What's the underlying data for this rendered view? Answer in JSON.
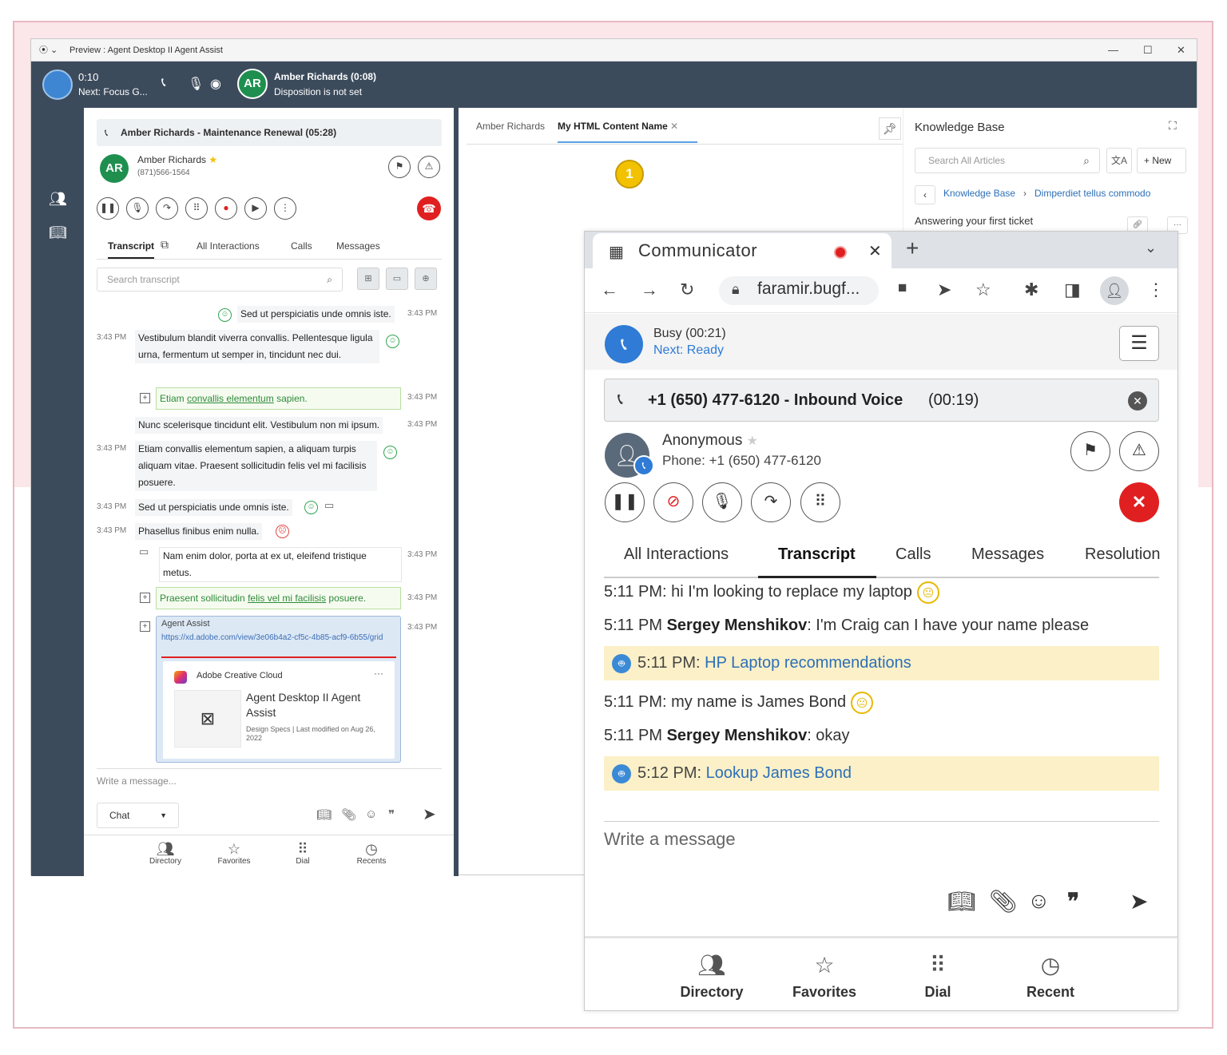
{
  "window": {
    "title": "Preview : Agent Desktop II Agent Assist"
  },
  "topbar": {
    "timer": "0:10",
    "next": "Next: Focus G...",
    "contact_initials": "AR",
    "contact_name": "Amber Richards  (0:08)",
    "disposition": "Disposition is not set"
  },
  "agent": {
    "call_header": "Amber Richards - Maintenance Renewal  (05:28)",
    "contact_initials": "AR",
    "contact_name": "Amber Richards",
    "contact_phone": "(871)566-1564",
    "tabs": [
      "Transcript",
      "All Interactions",
      "Calls",
      "Messages"
    ],
    "search_placeholder": "Search transcript",
    "transcript": [
      {
        "text": "Sed ut perspiciatis unde omnis iste.",
        "time": "3:43 PM"
      },
      {
        "text": "Vestibulum blandit viverra convallis. Pellentesque ligula urna, fermentum ut semper in, tincidunt nec dui.",
        "time": "3:43 PM"
      },
      {
        "text_before": "Etiam ",
        "link": "convallis elementum",
        "text_after": " sapien.",
        "time": "3:43 PM"
      },
      {
        "text": "Nunc scelerisque tincidunt elit. Vestibulum non mi ipsum.",
        "time": "3:43 PM"
      },
      {
        "text": "Etiam convallis elementum sapien, a aliquam turpis aliquam vitae. Praesent sollicitudin felis vel mi facilisis posuere.",
        "time": "3:43 PM"
      },
      {
        "text": "Sed ut perspiciatis unde omnis iste.",
        "time": "3:43 PM"
      },
      {
        "text": "Phasellus finibus enim nulla.",
        "time": "3:43 PM"
      },
      {
        "text": "Nam enim dolor, porta at ex ut, eleifend tristique metus.",
        "time": "3:43 PM"
      },
      {
        "text_before": "Praesent sollicitudin ",
        "link": "felis vel mi facilisis",
        "text_after": " posuere.",
        "time": "3:43 PM"
      }
    ],
    "agent_assist": {
      "title": "Agent Assist",
      "link": "https://xd.adobe.com/view/3e06b4a2-cf5c-4b85-acf9-6b55/grid",
      "time": "3:43 PM",
      "app_name": "Adobe Creative Cloud",
      "card_title": "Agent Desktop II Agent Assist",
      "card_sub": "Design Specs | Last modified on Aug 26, 2022"
    },
    "compose_placeholder": "Write a message...",
    "channel": "Chat",
    "footer": [
      "Directory",
      "Favorites",
      "Dial",
      "Recents"
    ]
  },
  "middle": {
    "tabs": [
      "Amber Richards",
      "My HTML Content Name"
    ],
    "badge": "1"
  },
  "knowledge_base": {
    "title": "Knowledge Base",
    "search_placeholder": "Search All Articles",
    "new_label": "New",
    "crumb_root": "Knowledge Base",
    "crumb_item": "Dimperdiet tellus commodo",
    "article": "Answering your first ticket"
  },
  "communicator": {
    "tab_title": "Communicator",
    "url": "faramir.bugf...",
    "status": "Busy  (00:21)",
    "next": "Next: Ready",
    "call_number": "+1 (650) 477-6120 - Inbound Voice",
    "call_duration": "(00:19)",
    "caller_name": "Anonymous",
    "caller_phone": "Phone: +1 (650) 477-6120",
    "tabs": [
      "All Interactions",
      "Transcript",
      "Calls",
      "Messages",
      "Resolution"
    ],
    "transcript": [
      {
        "time": "5:11 PM:",
        "speaker": "",
        "text": " hi I'm looking to replace my laptop"
      },
      {
        "time": "5:11 PM",
        "speaker": "Sergey Menshikov",
        "text": ": I'm Craig can I have your name please"
      },
      {
        "time": "5:11 PM:",
        "link": "HP Laptop recommendations"
      },
      {
        "time": "5:11 PM:",
        "speaker": "",
        "text": " my name is James Bond"
      },
      {
        "time": "5:11 PM",
        "speaker": "Sergey Menshikov",
        "text": ": okay"
      },
      {
        "time": "5:12 PM:",
        "link": "Lookup James Bond"
      }
    ],
    "compose_placeholder": "Write a message",
    "footer": [
      "Directory",
      "Favorites",
      "Dial",
      "Recent"
    ]
  },
  "colors": {
    "dark_nav": "#3c4b5c",
    "accent_blue": "#2f7bd6",
    "end_call_red": "#e02020",
    "highlight_yellow": "#fbf0c7",
    "badge_yellow": "#f2c200"
  }
}
